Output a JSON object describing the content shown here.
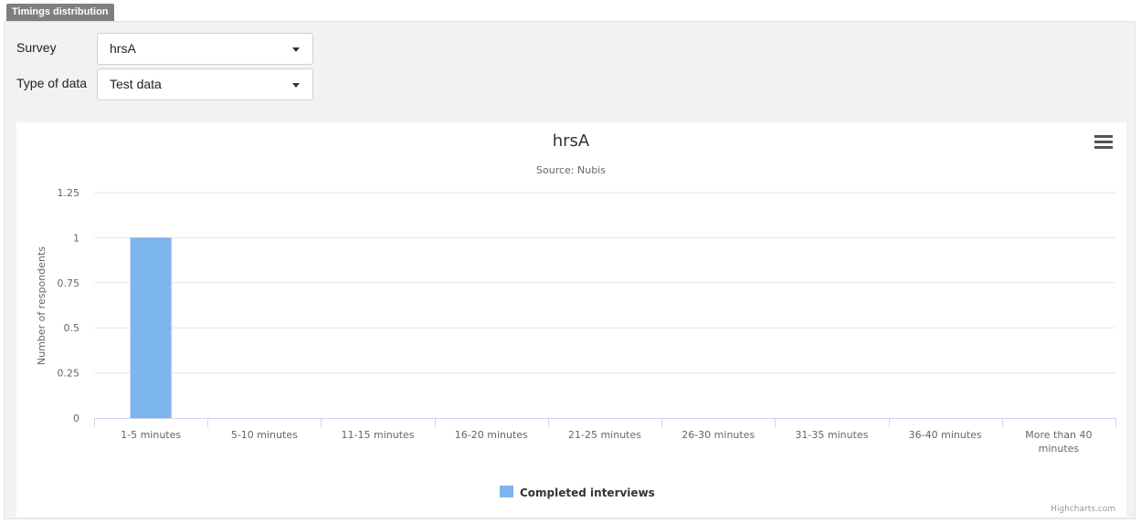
{
  "panel": {
    "tab_label": "Timings distribution"
  },
  "filters": {
    "survey_label": "Survey",
    "survey_value": "hrsA",
    "type_label": "Type of data",
    "type_value": "Test data"
  },
  "icons": {
    "menu": "hamburger-menu-icon",
    "caret": "caret-down-icon"
  },
  "credits": "Highcharts.com",
  "colors": {
    "bar": "#7cb5ec",
    "grid": "#e6e6e6",
    "axis": "#ccd6eb"
  },
  "chart_data": {
    "type": "bar",
    "title": "hrsA",
    "subtitle": "Source: Nubis",
    "xlabel": "",
    "ylabel": "Number of respondents",
    "categories": [
      "1-5 minutes",
      "5-10 minutes",
      "11-15 minutes",
      "16-20 minutes",
      "21-25 minutes",
      "26-30 minutes",
      "31-35 minutes",
      "36-40 minutes",
      "More than 40 minutes"
    ],
    "category_lines": [
      [
        "1-5 minutes"
      ],
      [
        "5-10 minutes"
      ],
      [
        "11-15 minutes"
      ],
      [
        "16-20 minutes"
      ],
      [
        "21-25 minutes"
      ],
      [
        "26-30 minutes"
      ],
      [
        "31-35 minutes"
      ],
      [
        "36-40 minutes"
      ],
      [
        "More than 40",
        "minutes"
      ]
    ],
    "series": [
      {
        "name": "Completed interviews",
        "values": [
          1,
          0,
          0,
          0,
          0,
          0,
          0,
          0,
          0
        ]
      }
    ],
    "yticks": [
      "0",
      "0.25",
      "0.5",
      "0.75",
      "1",
      "1.25"
    ],
    "ylim": [
      0,
      1.25
    ],
    "grid": true,
    "legend": "bottom-center"
  }
}
